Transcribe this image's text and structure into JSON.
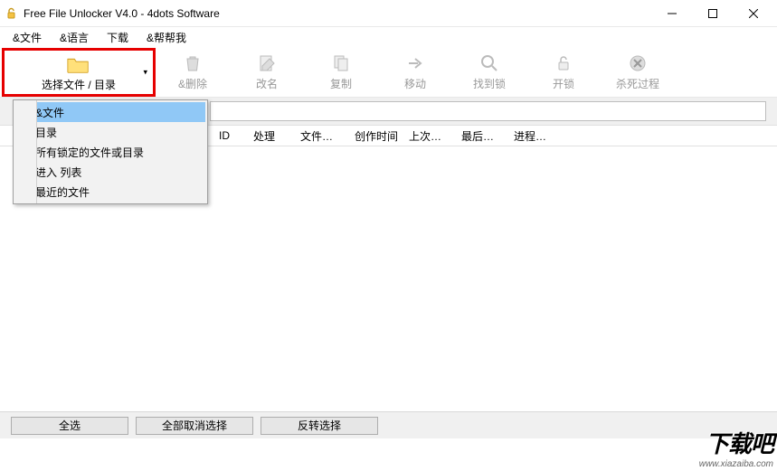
{
  "window": {
    "title": "Free File Unlocker V4.0 - 4dots Software"
  },
  "menu": {
    "file": "&文件",
    "language": "&语言",
    "download": "下载",
    "help": "&帮帮我"
  },
  "toolbar": {
    "select": "选择文件 / 目录",
    "delete": "&删除",
    "rename": "改名",
    "copy": "复制",
    "move": "移动",
    "findlock": "找到锁",
    "unlock": "开锁",
    "kill": "杀死过程"
  },
  "dropdown": {
    "items": [
      "&文件",
      "目录",
      "所有锁定的文件或目录",
      "进入 列表",
      "最近的文件"
    ]
  },
  "columns": {
    "id": "ID",
    "process": "处理",
    "file": "文件…",
    "created": "创作时间",
    "last": "上次…",
    "mod": "最后…",
    "prog": "进程…"
  },
  "bottom": {
    "selectAll": "全选",
    "deselectAll": "全部取消选择",
    "invert": "反转选择"
  },
  "watermark": {
    "brand": "下载吧",
    "url": "www.xiazaiba.com"
  }
}
